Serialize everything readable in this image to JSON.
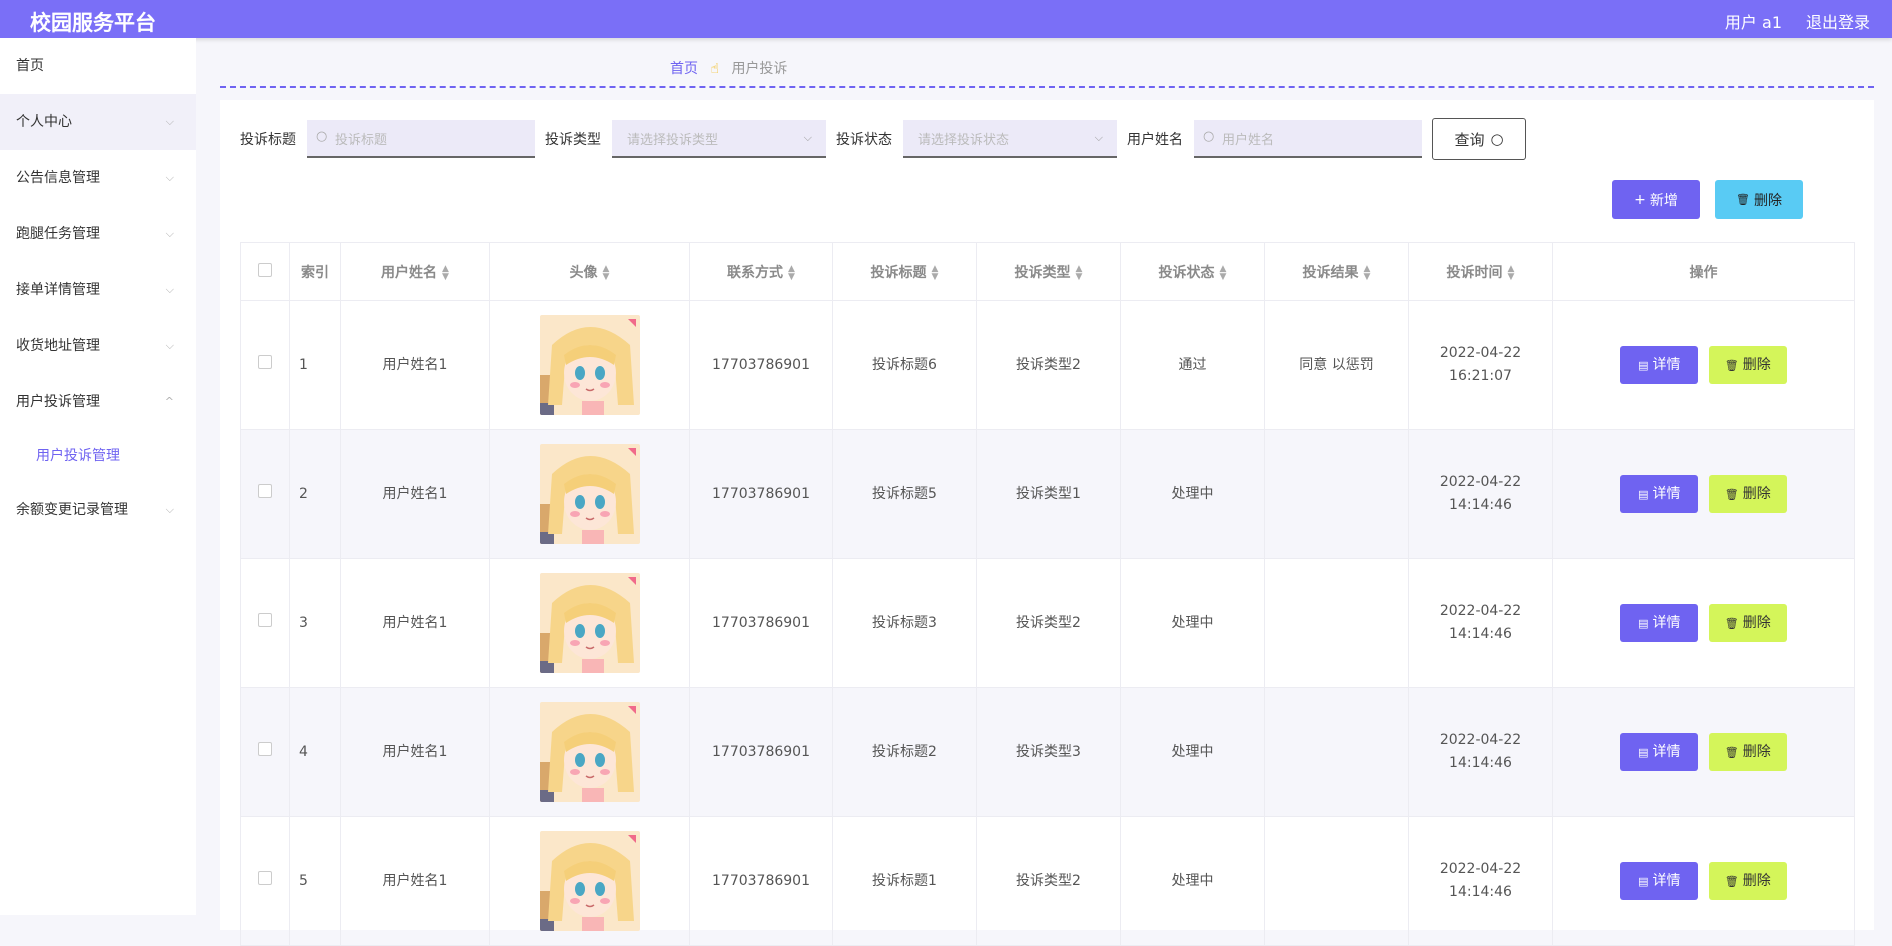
{
  "header": {
    "brand": "校园服务平台",
    "user": "用户 a1",
    "logout": "退出登录"
  },
  "sidebar": {
    "items": [
      {
        "label": "首页",
        "chevron": ""
      },
      {
        "label": "个人中心",
        "chevron": "⌵"
      },
      {
        "label": "公告信息管理",
        "chevron": "⌵"
      },
      {
        "label": "跑腿任务管理",
        "chevron": "⌵"
      },
      {
        "label": "接单详情管理",
        "chevron": "⌵"
      },
      {
        "label": "收货地址管理",
        "chevron": "⌵"
      },
      {
        "label": "用户投诉管理",
        "chevron": "^"
      },
      {
        "label": "余额变更记录管理",
        "chevron": "⌵"
      }
    ],
    "submenu": {
      "label": "用户投诉管理"
    }
  },
  "breadcrumb": {
    "home": "首页",
    "current": "用户投诉"
  },
  "search": {
    "title_label": "投诉标题",
    "title_placeholder": "投诉标题",
    "type_label": "投诉类型",
    "type_placeholder": "请选择投诉类型",
    "status_label": "投诉状态",
    "status_placeholder": "请选择投诉状态",
    "name_label": "用户姓名",
    "name_placeholder": "用户姓名",
    "query_label": "查询"
  },
  "actions": {
    "add_label": "新增",
    "delete_label": "删除"
  },
  "table": {
    "headers": [
      "索引",
      "用户姓名",
      "头像",
      "联系方式",
      "投诉标题",
      "投诉类型",
      "投诉状态",
      "投诉结果",
      "投诉时间",
      "操作"
    ],
    "rows": [
      {
        "index": "1",
        "name": "用户姓名1",
        "phone": "17703786901",
        "title": "投诉标题6",
        "type": "投诉类型2",
        "status": "通过",
        "result": "同意 以惩罚",
        "time": "2022-04-22 16:21:07"
      },
      {
        "index": "2",
        "name": "用户姓名1",
        "phone": "17703786901",
        "title": "投诉标题5",
        "type": "投诉类型1",
        "status": "处理中",
        "result": "",
        "time": "2022-04-22 14:14:46"
      },
      {
        "index": "3",
        "name": "用户姓名1",
        "phone": "17703786901",
        "title": "投诉标题3",
        "type": "投诉类型2",
        "status": "处理中",
        "result": "",
        "time": "2022-04-22 14:14:46"
      },
      {
        "index": "4",
        "name": "用户姓名1",
        "phone": "17703786901",
        "title": "投诉标题2",
        "type": "投诉类型3",
        "status": "处理中",
        "result": "",
        "time": "2022-04-22 14:14:46"
      },
      {
        "index": "5",
        "name": "用户姓名1",
        "phone": "17703786901",
        "title": "投诉标题1",
        "type": "投诉类型2",
        "status": "处理中",
        "result": "",
        "time": "2022-04-22 14:14:46"
      }
    ],
    "detail_label": "详情",
    "delete_label": "删除"
  },
  "colors": {
    "primary": "#6f63f1",
    "topbar": "#7a6ff7",
    "delete_row": "#d4f55a",
    "delete_batch": "#59cbf4"
  },
  "icons": {
    "search": "search-icon",
    "sort": "sort-icon",
    "detail": "document-icon",
    "delete": "trash-icon",
    "add": "plus-icon",
    "breadcrumb": "hand-pointer-icon"
  }
}
